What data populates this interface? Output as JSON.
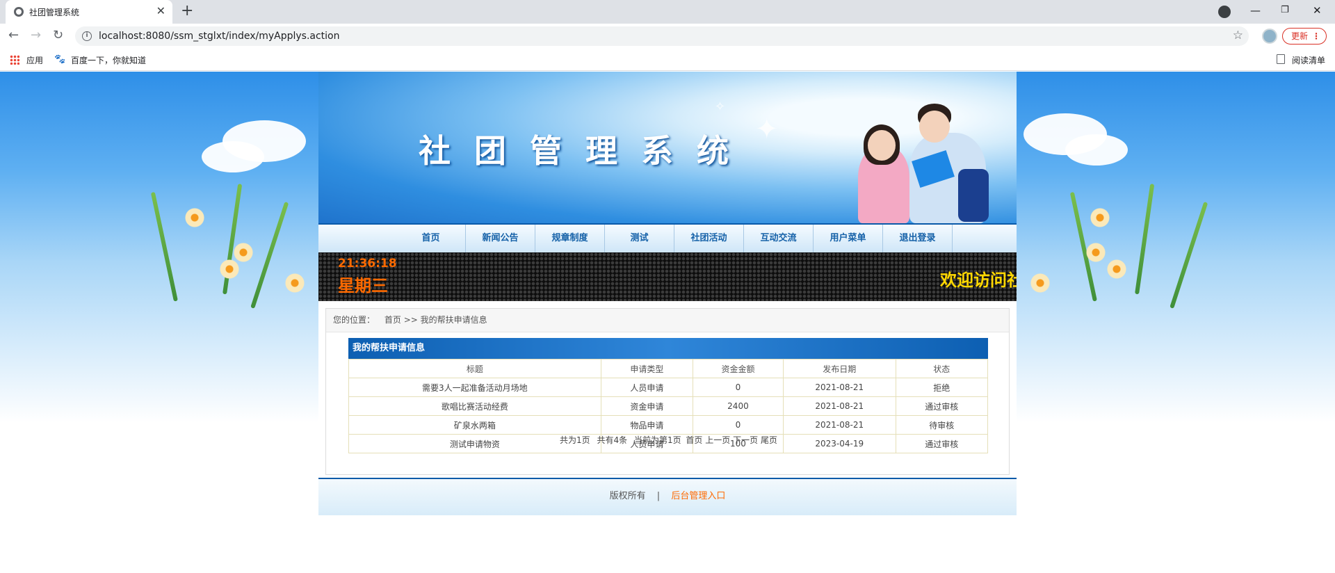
{
  "browser": {
    "tab_title": "社团管理系统",
    "url": "localhost:8080/ssm_stglxt/index/myApplys.action",
    "update_label": "更新",
    "bookmarks": [
      "应用",
      "百度一下，你就知道"
    ],
    "reading_list": "阅读清单"
  },
  "site": {
    "title": "社团管理系统",
    "nav": [
      "首页",
      "新闻公告",
      "规章制度",
      "测试",
      "社团活动",
      "互动交流",
      "用户菜单",
      "退出登录"
    ],
    "ticker": {
      "time": "21:36:18",
      "weekday": "星期三",
      "welcome": "欢迎访问社"
    },
    "breadcrumb": {
      "label": "您的位置：",
      "home": "首页",
      "separator": ">>",
      "current": "我的帮扶申请信息"
    },
    "panel_title": "我的帮扶申请信息",
    "table": {
      "headers": [
        "标题",
        "申请类型",
        "资金金额",
        "发布日期",
        "状态"
      ],
      "rows": [
        [
          "需要3人一起准备活动月场地",
          "人员申请",
          "0",
          "2021-08-21",
          "拒绝"
        ],
        [
          "歌唱比赛活动经费",
          "资金申请",
          "2400",
          "2021-08-21",
          "通过审核"
        ],
        [
          "矿泉水两箱",
          "物品申请",
          "0",
          "2021-08-21",
          "待审核"
        ],
        [
          "测试申请物资",
          "人员申请",
          "100",
          "2023-04-19",
          "通过审核"
        ]
      ]
    },
    "pager": [
      "共为1页",
      "共有4条",
      "当前为第1页",
      "首页",
      "上一页",
      "下一页",
      "尾页"
    ],
    "footer": {
      "copyright": "版权所有",
      "separator": "|",
      "admin_link": "后台管理入口"
    }
  }
}
